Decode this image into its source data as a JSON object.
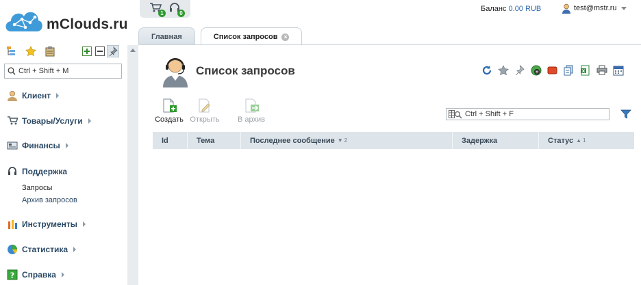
{
  "app": {
    "logo_text": "mClouds.ru",
    "quick": {
      "cart_count": "1",
      "support_count": "0"
    },
    "balance_label": "Баланс",
    "balance_value": "0.00 RUB",
    "user": "test@mstr.ru"
  },
  "tabs": [
    {
      "label": "Главная"
    },
    {
      "label": "Список запросов"
    }
  ],
  "sidebar": {
    "search_placeholder": "Ctrl + Shift + M",
    "groups": [
      {
        "label": "Клиент",
        "icon": "client-icon"
      },
      {
        "label": "Товары/Услуги",
        "icon": "cart-icon"
      },
      {
        "label": "Финансы",
        "icon": "finance-icon"
      },
      {
        "label": "Поддержка",
        "icon": "headset-icon"
      },
      {
        "label": "Инструменты",
        "icon": "tools-icon"
      },
      {
        "label": "Статистика",
        "icon": "stats-icon"
      },
      {
        "label": "Справка",
        "icon": "help-icon"
      }
    ],
    "support_items": [
      {
        "label": "Запросы"
      },
      {
        "label": "Архив запросов"
      }
    ]
  },
  "main": {
    "title": "Список запросов",
    "actions": [
      {
        "label": "Создать"
      },
      {
        "label": "Открыть"
      },
      {
        "label": "В архив"
      }
    ],
    "grid_search_placeholder": "Ctrl + Shift + F",
    "columns": [
      {
        "label": "Id"
      },
      {
        "label": "Тема"
      },
      {
        "label": "Последнее сообщение",
        "sort": "2"
      },
      {
        "label": "Задержка"
      },
      {
        "label": "Статус",
        "sort": "1"
      }
    ]
  },
  "colors": {
    "accent": "#2a6ab0",
    "grid_header": "#dde4ea",
    "nav_text": "#2c4a66"
  }
}
